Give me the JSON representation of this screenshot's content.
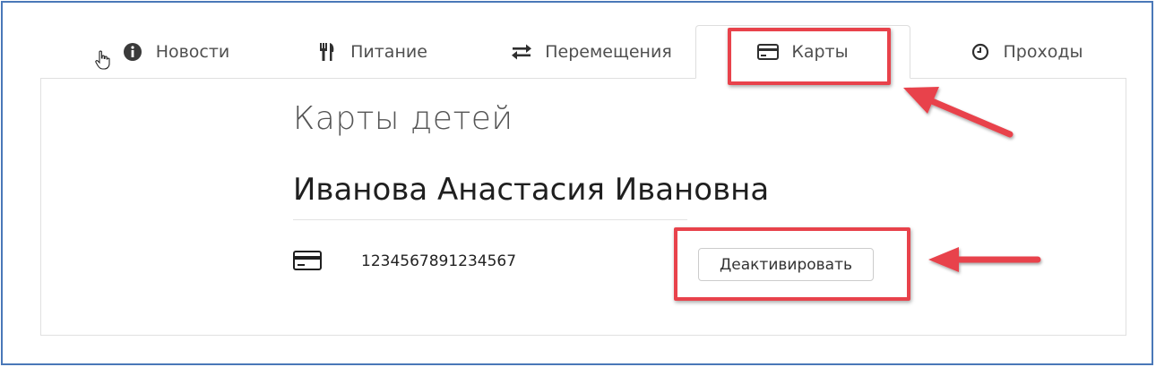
{
  "tabs": [
    {
      "label": "Новости",
      "icon": "info-icon"
    },
    {
      "label": "Питание",
      "icon": "cutlery-icon"
    },
    {
      "label": "Перемещения",
      "icon": "transfer-arrows-icon"
    },
    {
      "label": "Карты",
      "icon": "credit-card-icon",
      "active": true
    },
    {
      "label": "Проходы",
      "icon": "clock-icon"
    }
  ],
  "page": {
    "title": "Карты детей",
    "child_name": "Иванова Анастасия Ивановна"
  },
  "card": {
    "icon": "credit-card-icon",
    "number": "1234567891234567",
    "deactivate_label": "Деактивировать"
  },
  "annotations": {
    "highlight_color": "#e8424b",
    "frame_color": "#4a78b8"
  }
}
